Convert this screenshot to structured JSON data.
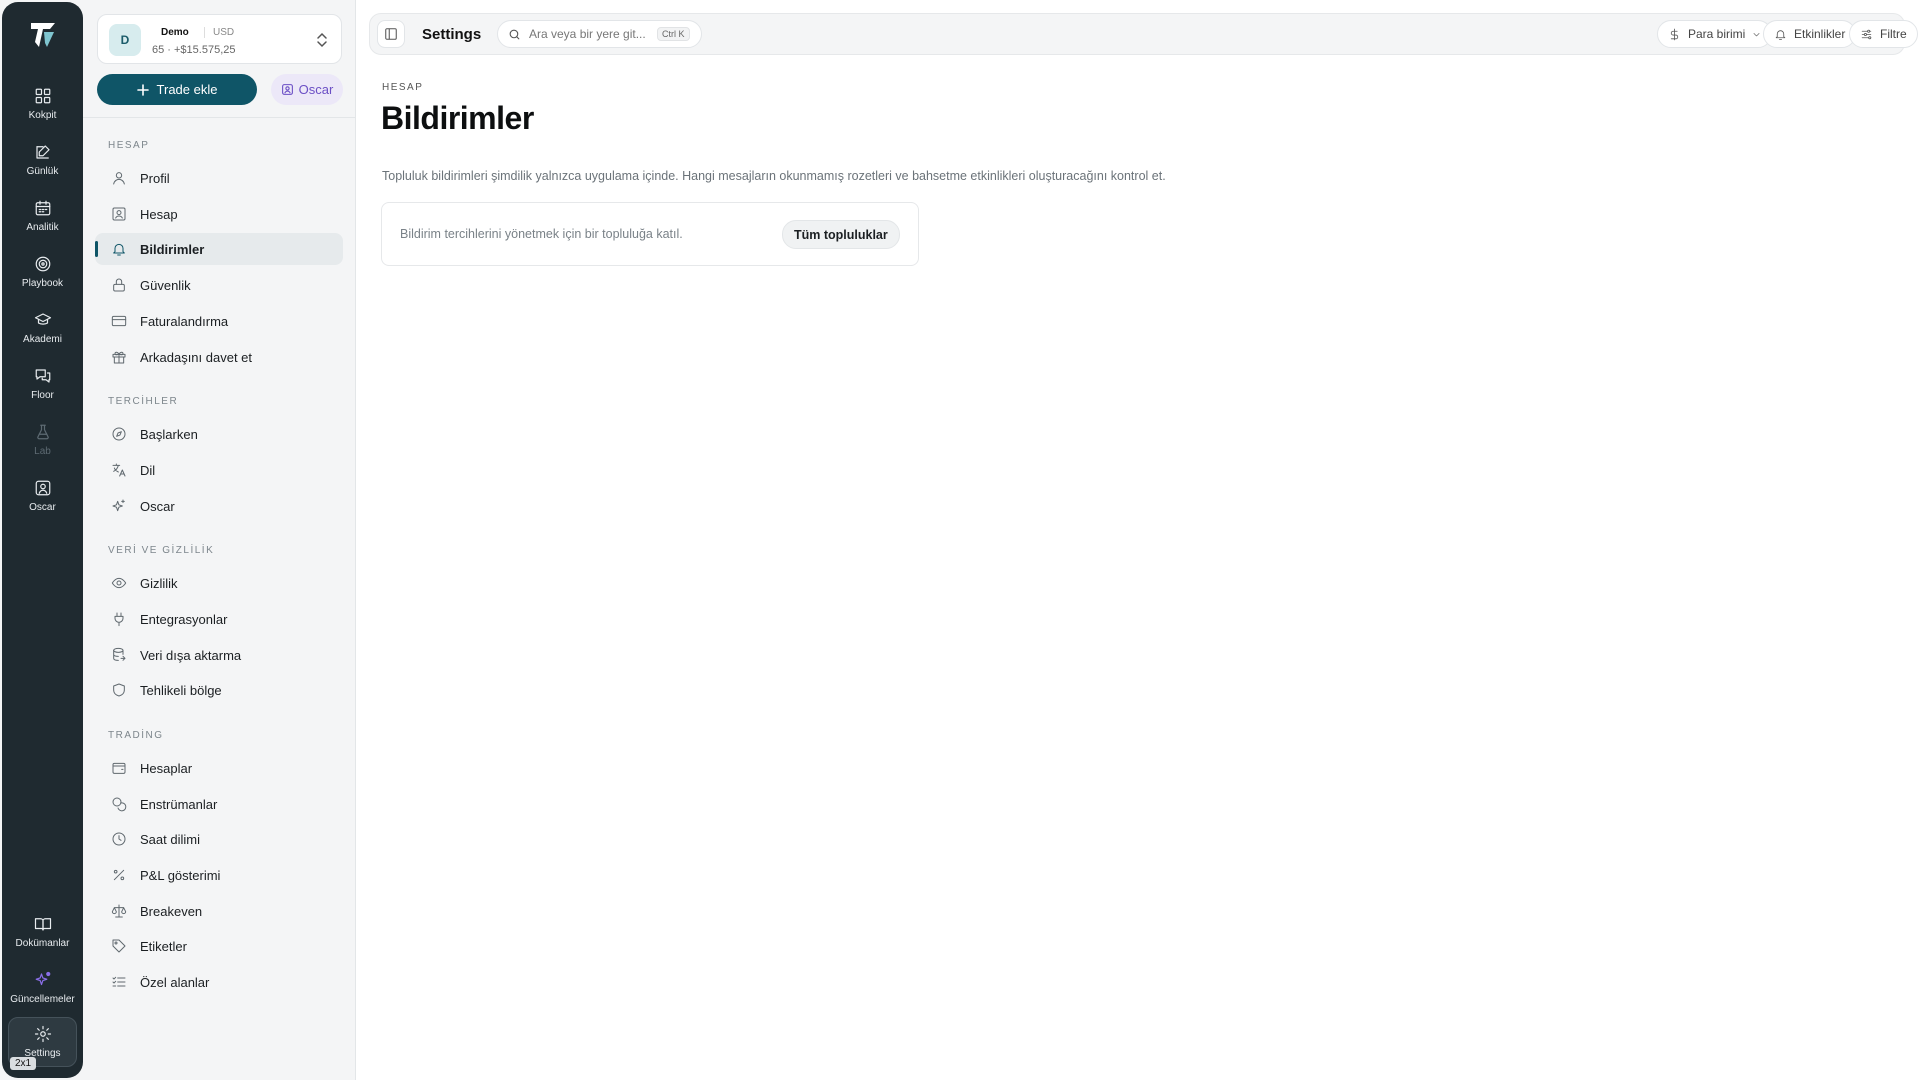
{
  "rail": {
    "items": [
      {
        "label": "Kokpit"
      },
      {
        "label": "Günlük"
      },
      {
        "label": "Analitik"
      },
      {
        "label": "Playbook"
      },
      {
        "label": "Akademi"
      },
      {
        "label": "Floor"
      },
      {
        "label": "Lab"
      },
      {
        "label": "Oscar"
      }
    ],
    "bottom": [
      {
        "label": "Dokümanlar"
      },
      {
        "label": "Güncellemeler"
      },
      {
        "label": "Settings"
      }
    ],
    "badge": "2x1"
  },
  "account": {
    "avatar": "D",
    "name": "Demo",
    "currency": "USD",
    "summary": "65 · +$15.575,25"
  },
  "sidebar": {
    "trade_button": "Trade ekle",
    "oscar_button": "Oscar",
    "sections": [
      {
        "title": "HESAP",
        "items": [
          {
            "label": "Profil"
          },
          {
            "label": "Hesap"
          },
          {
            "label": "Bildirimler"
          },
          {
            "label": "Güvenlik"
          },
          {
            "label": "Faturalandırma"
          },
          {
            "label": "Arkadaşını davet et"
          }
        ]
      },
      {
        "title": "TERCİHLER",
        "items": [
          {
            "label": "Başlarken"
          },
          {
            "label": "Dil"
          },
          {
            "label": "Oscar"
          }
        ]
      },
      {
        "title": "VERİ VE GİZLİLİK",
        "items": [
          {
            "label": "Gizlilik"
          },
          {
            "label": "Entegrasyonlar"
          },
          {
            "label": "Veri dışa aktarma"
          },
          {
            "label": "Tehlikeli bölge"
          }
        ]
      },
      {
        "title": "TRADİNG",
        "items": [
          {
            "label": "Hesaplar"
          },
          {
            "label": "Enstrümanlar"
          },
          {
            "label": "Saat dilimi"
          },
          {
            "label": "P&L gösterimi"
          },
          {
            "label": "Breakeven"
          },
          {
            "label": "Etiketler"
          },
          {
            "label": "Özel alanlar"
          }
        ]
      }
    ]
  },
  "topbar": {
    "title": "Settings",
    "search_placeholder": "Ara veya bir yere git...",
    "shortcut": "Ctrl K",
    "currency_button": "Para birimi",
    "events_button": "Etkinlikler",
    "filter_button": "Filtre"
  },
  "page": {
    "breadcrumb": "HESAP",
    "title": "Bildirimler",
    "description": "Topluluk bildirimleri şimdilik yalnızca uygulama içinde. Hangi mesajların okunmamış rozetleri ve bahsetme etkinlikleri oluşturacağını kontrol et.",
    "card_text": "Bildirim tercihlerini yönetmek için bir topluluğa katıl.",
    "card_button": "Tüm topluluklar"
  },
  "colors": {
    "rail_bg": "#1f2a30",
    "primary": "#0f5567",
    "oscar_accent": "#6b4fc5"
  }
}
